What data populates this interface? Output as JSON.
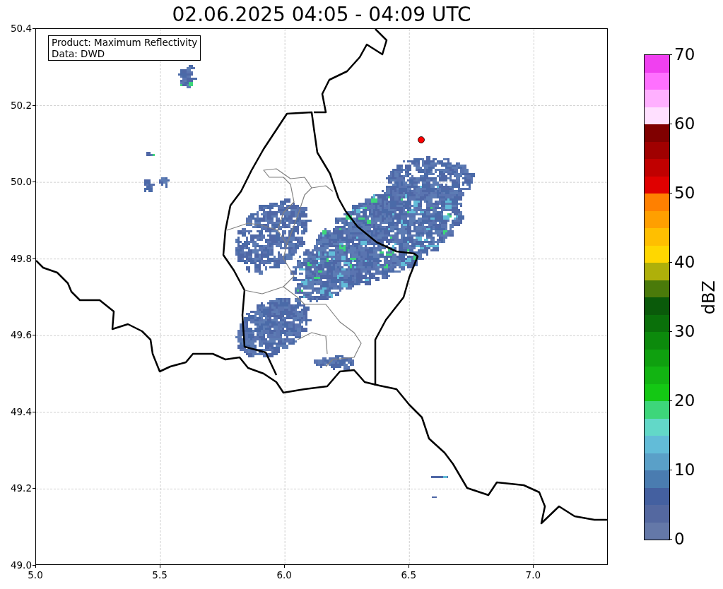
{
  "title": "02.06.2025 04:05 - 04:09 UTC",
  "map": {
    "legend": [
      "Product: Maximum Reflectivity",
      "Data: DWD"
    ],
    "xticks": [
      "5.0",
      "5.5",
      "6.0",
      "6.5",
      "7.0"
    ],
    "yticks": [
      "50.4",
      "50.2",
      "50.0",
      "49.8",
      "49.6",
      "49.4",
      "49.2",
      "49.0"
    ]
  },
  "colorbar": {
    "label": "dBZ",
    "ticks": [
      "70",
      "60",
      "50",
      "40",
      "30",
      "20",
      "10",
      "0"
    ],
    "segments": [
      {
        "color": "#6478a8"
      },
      {
        "color": "#5468a0"
      },
      {
        "color": "#4460a0"
      },
      {
        "color": "#4a7cb0"
      },
      {
        "color": "#5aa0c8"
      },
      {
        "color": "#62bcd8"
      },
      {
        "color": "#62d8c8"
      },
      {
        "color": "#3dd67a"
      },
      {
        "color": "#14c814"
      },
      {
        "color": "#12b412"
      },
      {
        "color": "#0fa00f"
      },
      {
        "color": "#0c8a0c"
      },
      {
        "color": "#0a700a"
      },
      {
        "color": "#0a5a0a"
      },
      {
        "color": "#4a7a0a"
      },
      {
        "color": "#afb00a"
      },
      {
        "color": "#ffd700"
      },
      {
        "color": "#ffbf00"
      },
      {
        "color": "#ff9f00"
      },
      {
        "color": "#ff8000"
      },
      {
        "color": "#e00000"
      },
      {
        "color": "#c00000"
      },
      {
        "color": "#a00000"
      },
      {
        "color": "#800000"
      },
      {
        "color": "#ffe0ff"
      },
      {
        "color": "#ffb0ff"
      },
      {
        "color": "#ff70ff"
      },
      {
        "color": "#f040f0"
      }
    ]
  }
}
